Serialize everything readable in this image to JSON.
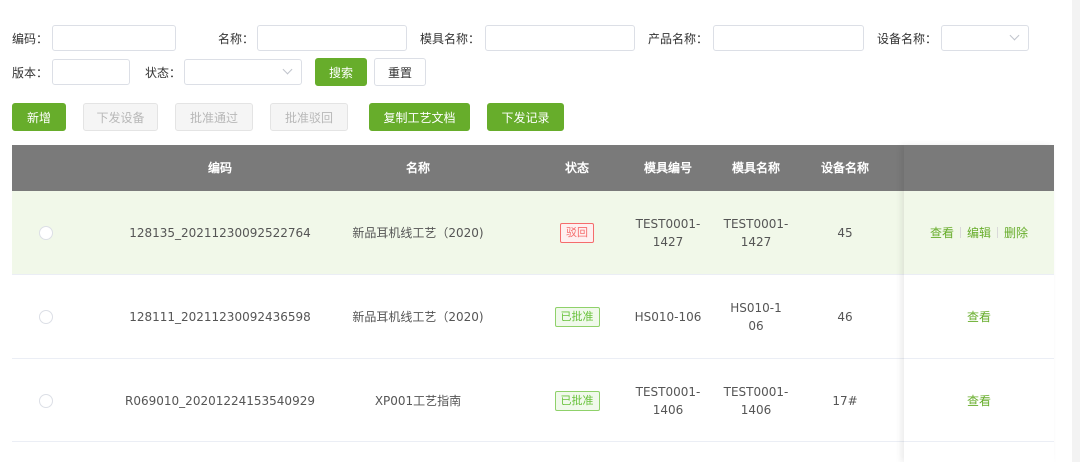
{
  "filters": {
    "code_label": "编码：",
    "name_label": "名称：",
    "mold_name_label": "模具名称：",
    "product_name_label": "产品名称：",
    "device_name_label": "设备名称：",
    "version_label": "版本：",
    "status_label": "状态：",
    "search_button": "搜索",
    "reset_button": "重置"
  },
  "toolbar": {
    "add": "新增",
    "issue_device": "下发设备",
    "approve_pass": "批准通过",
    "approve_reject": "批准驳回",
    "copy_doc": "复制工艺文档",
    "issue_record": "下发记录"
  },
  "table": {
    "columns": {
      "code": "编码",
      "name": "名称",
      "status": "状态",
      "mold_no": "模具编号",
      "mold_name": "模具名称",
      "device_name": "设备名称"
    },
    "rows": [
      {
        "code": "128135_20211230092522764",
        "name": "新品耳机线工艺（2020)",
        "status": "驳回",
        "mold_no": "TEST0001-1427",
        "mold_name": "TEST0001-1427",
        "device_name": "45",
        "actions": {
          "view": "查看",
          "edit": "编辑",
          "delete": "删除"
        }
      },
      {
        "code": "128111_20211230092436598",
        "name": "新品耳机线工艺（2020)",
        "status": "已批准",
        "mold_no": "HS010-106",
        "mold_name": "HS010-106",
        "device_name": "46",
        "actions": {
          "view": "查看"
        }
      },
      {
        "code": "R069010_20201224153540929",
        "name": "XP001工艺指南",
        "status": "已批准",
        "mold_no": "TEST0001-1406",
        "mold_name": "TEST0001-1406",
        "device_name": "17#",
        "actions": {
          "view": "查看"
        }
      }
    ]
  },
  "colors": {
    "accent": "#67ad2b",
    "header_bg": "#7a7a7a",
    "highlight_row": "#f1f8e9",
    "reject_tag": "#f56c6c",
    "approved_tag": "#67c23a"
  }
}
